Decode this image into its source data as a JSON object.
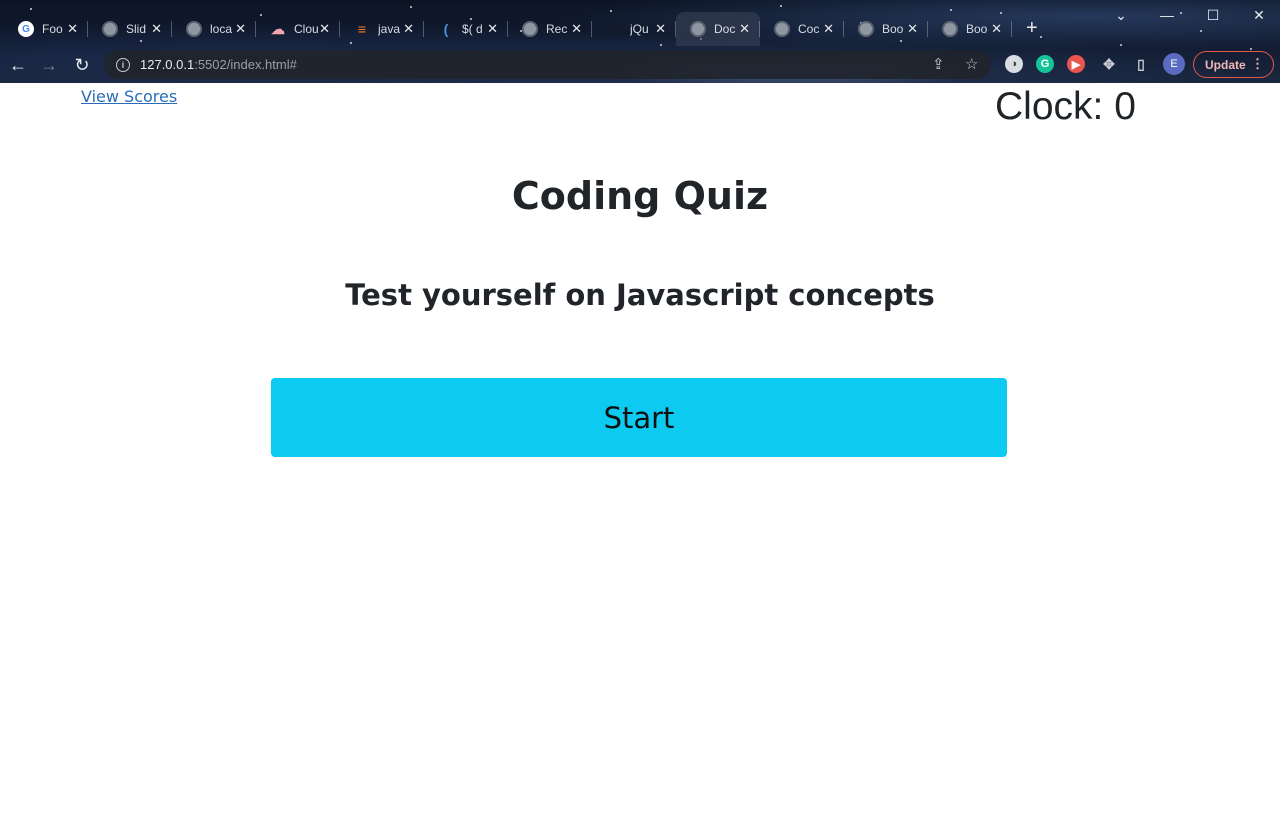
{
  "browser": {
    "tabs": [
      {
        "label": "Foo",
        "icon": "google-icon",
        "fav_text": "G",
        "fav_color": "#ffffff"
      },
      {
        "label": "Slid",
        "icon": "globe-icon"
      },
      {
        "label": "loca",
        "icon": "globe-icon"
      },
      {
        "label": "Clou",
        "icon": "cloud-icon",
        "fav_text": "☁",
        "fav_color": "#f1a7b0"
      },
      {
        "label": "java",
        "icon": "stackoverflow-icon",
        "fav_text": "≡",
        "fav_color": "#f48024"
      },
      {
        "label": "$( d",
        "icon": "jquery-icon",
        "fav_text": "(",
        "fav_color": "#4a8fd8"
      },
      {
        "label": "Rec",
        "icon": "globe-icon"
      },
      {
        "label": "jQu",
        "icon": "jquery-icon",
        "fav_text": "(",
        "fav_color": "#1b1b1b"
      },
      {
        "label": "Doc",
        "icon": "globe-icon"
      },
      {
        "label": "Coc",
        "icon": "globe-icon"
      },
      {
        "label": "Boo",
        "icon": "globe-icon"
      },
      {
        "label": "Boo",
        "icon": "globe-icon"
      }
    ],
    "active_tab_index": 8,
    "close_glyph": "✕",
    "new_tab_glyph": "+",
    "url_host": "127.0.0.1",
    "url_rest": ":5502/index.html#",
    "avatar_letter": "E",
    "update_label": "Update",
    "update_dots": "⋮",
    "extensions": [
      {
        "name": "extension-1-icon",
        "text": "◑",
        "color": "#d9dce1"
      },
      {
        "name": "grammarly-icon",
        "text": "G",
        "color": "#15c39a"
      },
      {
        "name": "extension-3-icon",
        "text": "▶",
        "color": "#e8564f"
      }
    ]
  },
  "page": {
    "view_scores": "View Scores",
    "clock": "Clock: 0",
    "title": "Coding Quiz",
    "subtitle": "Test yourself on Javascript concepts",
    "start_label": "Start"
  },
  "colors": {
    "accent": "#0dcaf0",
    "link": "#2a6db6",
    "text": "#212529",
    "update": "#e3574b"
  }
}
